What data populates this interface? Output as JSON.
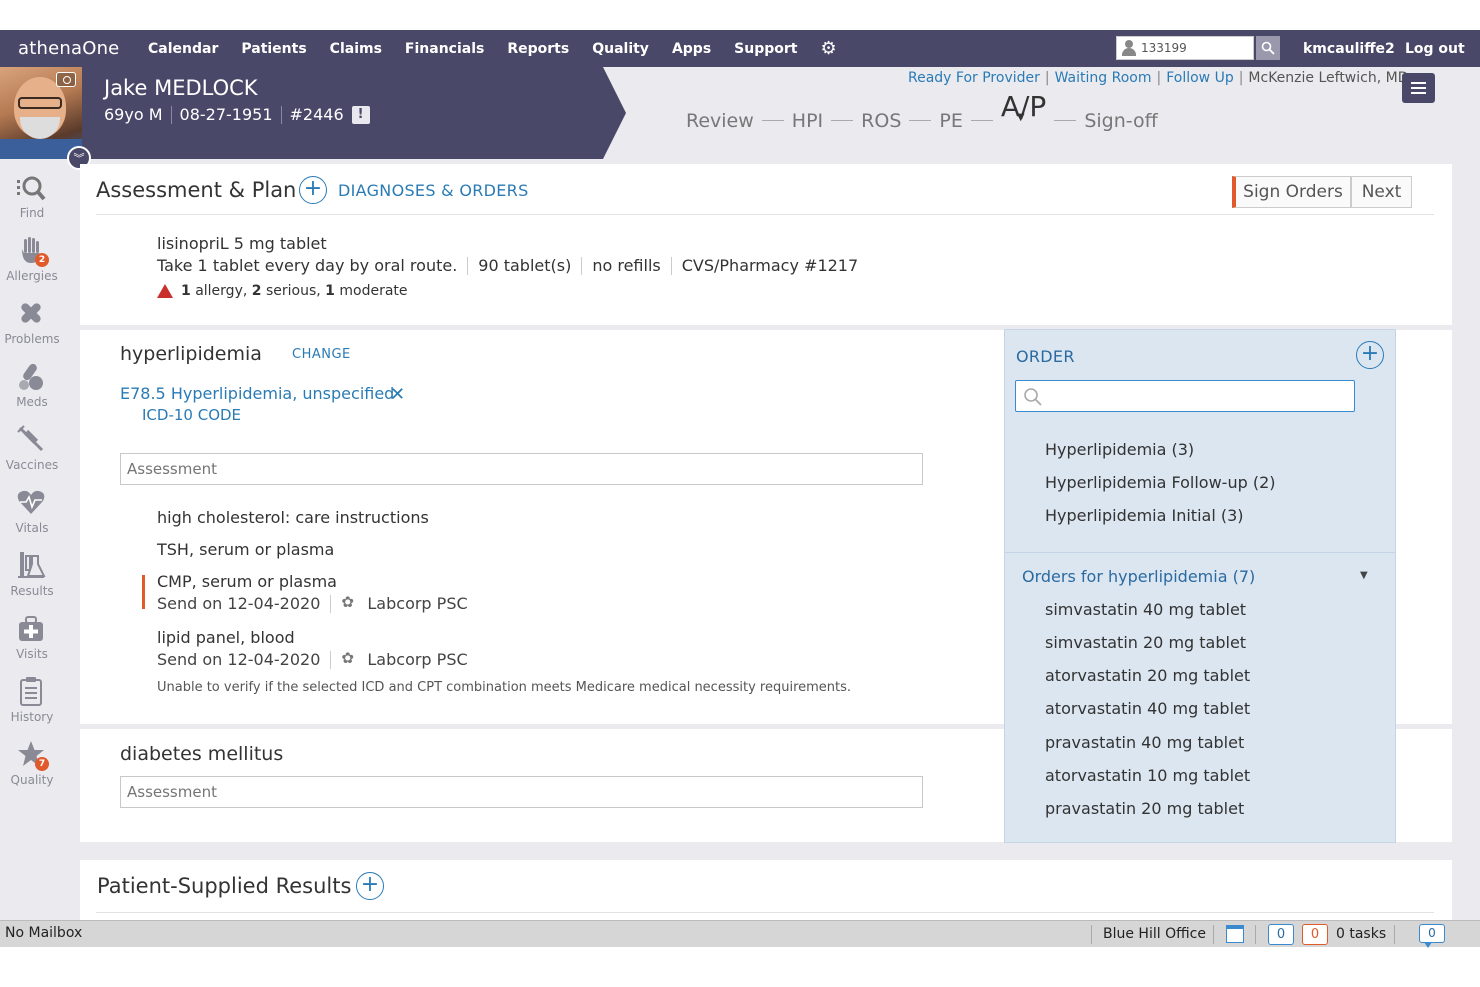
{
  "topnav": {
    "brand": "athenaOne",
    "items": [
      "Calendar",
      "Patients",
      "Claims",
      "Financials",
      "Reports",
      "Quality",
      "Apps",
      "Support"
    ],
    "search_value": "133199",
    "username": "kmcauliffe2",
    "logout": "Log out"
  },
  "patient": {
    "name": "Jake MEDLOCK",
    "age_sex": "69yo M",
    "dob": "08-27-1951",
    "id": "#2446",
    "alert_glyph": "!"
  },
  "encounter": {
    "status_links": [
      "Ready For Provider",
      "Waiting Room",
      "Follow Up"
    ],
    "provider": "McKenzie Leftwich, MD",
    "workflow": [
      "Review",
      "HPI",
      "ROS",
      "PE",
      "A/P",
      "Sign-off"
    ],
    "active_step": "A/P"
  },
  "sidebar": {
    "items": [
      {
        "label": "Find",
        "icon": "find-icon",
        "badge": ""
      },
      {
        "label": "Allergies",
        "icon": "allergies-icon",
        "badge": "2"
      },
      {
        "label": "Problems",
        "icon": "problems-icon",
        "badge": ""
      },
      {
        "label": "Meds",
        "icon": "meds-icon",
        "badge": ""
      },
      {
        "label": "Vaccines",
        "icon": "vaccines-icon",
        "badge": ""
      },
      {
        "label": "Vitals",
        "icon": "vitals-icon",
        "badge": ""
      },
      {
        "label": "Results",
        "icon": "results-icon",
        "badge": ""
      },
      {
        "label": "Visits",
        "icon": "visits-icon",
        "badge": ""
      },
      {
        "label": "History",
        "icon": "history-icon",
        "badge": ""
      },
      {
        "label": "Quality",
        "icon": "quality-icon",
        "badge": "7"
      }
    ]
  },
  "assessment_plan": {
    "title": "Assessment & Plan",
    "diagnoses_orders": "DIAGNOSES & ORDERS",
    "sign_orders": "Sign Orders",
    "next": "Next",
    "prescription": {
      "name": "lisinopriL 5 mg tablet",
      "sig": "Take 1 tablet every day by oral route.",
      "quantity": "90 tablet(s)",
      "refills": "no refills",
      "pharmacy": "CVS/Pharmacy #1217",
      "alert_allergy_count": "1",
      "alert_allergy_label": "allergy,",
      "alert_serious_count": "2",
      "alert_serious_label": "serious,",
      "alert_moderate_count": "1",
      "alert_moderate_label": "moderate"
    }
  },
  "diagnosis1": {
    "title": "hyperlipidemia",
    "change": "CHANGE",
    "icd_link": "E78.5 Hyperlipidemia, unspecified",
    "icd_label": "ICD-10 CODE",
    "assessment_placeholder": "Assessment",
    "orders": [
      {
        "name": "high cholesterol: care instructions"
      },
      {
        "name": "TSH, serum or plasma"
      },
      {
        "name": "CMP, serum or plasma",
        "send": "Send on 12-04-2020",
        "lab": "Labcorp PSC"
      },
      {
        "name": "lipid panel, blood",
        "send": "Send on 12-04-2020",
        "lab": "Labcorp PSC"
      }
    ],
    "warning": "Unable to verify if the selected ICD and CPT combination meets Medicare medical necessity requirements."
  },
  "diagnosis2": {
    "title": "diabetes mellitus",
    "assessment_placeholder": "Assessment"
  },
  "order_panel": {
    "title": "ORDER",
    "search_placeholder": "",
    "suggestions": [
      "Hyperlipidemia (3)",
      "Hyperlipidemia Follow-up (2)",
      "Hyperlipidemia Initial (3)"
    ],
    "group_title": "Orders for hyperlipidemia (7)",
    "group_items": [
      "simvastatin 40 mg tablet",
      "simvastatin 20 mg tablet",
      "atorvastatin 20 mg tablet",
      "atorvastatin 40 mg tablet",
      "pravastatin 40 mg tablet",
      "atorvastatin 10 mg tablet",
      "pravastatin 20 mg tablet"
    ]
  },
  "patient_supplied": {
    "title": "Patient-Supplied Results"
  },
  "statusbar": {
    "mailbox": "No Mailbox",
    "office": "Blue Hill Office",
    "count_blue": "0",
    "count_orange": "0",
    "tasks": "0 tasks",
    "chat_count": "0"
  },
  "colors": {
    "nav_bg": "#4a4868",
    "link": "#2a7bb5",
    "accent_orange": "#e05a2b",
    "order_panel_bg": "#dbe6f1"
  }
}
